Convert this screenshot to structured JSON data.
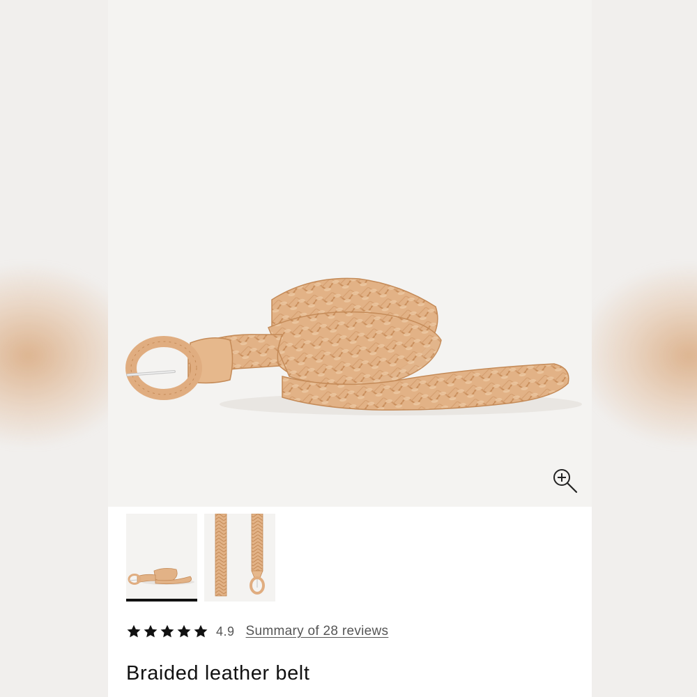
{
  "product": {
    "title": "Braided leather belt",
    "image_alt": "Braided leather belt",
    "colors": {
      "leather": "#e3b488",
      "leather_dark": "#c98f5c",
      "hero_bg": "#f4f3f1"
    }
  },
  "gallery": {
    "zoom_icon": "zoom-in-icon",
    "thumbnails": [
      {
        "alt": "Braided leather belt coiled view",
        "selected": true
      },
      {
        "alt": "Braided leather belt flat view",
        "selected": false
      }
    ]
  },
  "rating": {
    "stars": 5,
    "value": "4.9",
    "reviews_link": "Summary of 28 reviews"
  }
}
